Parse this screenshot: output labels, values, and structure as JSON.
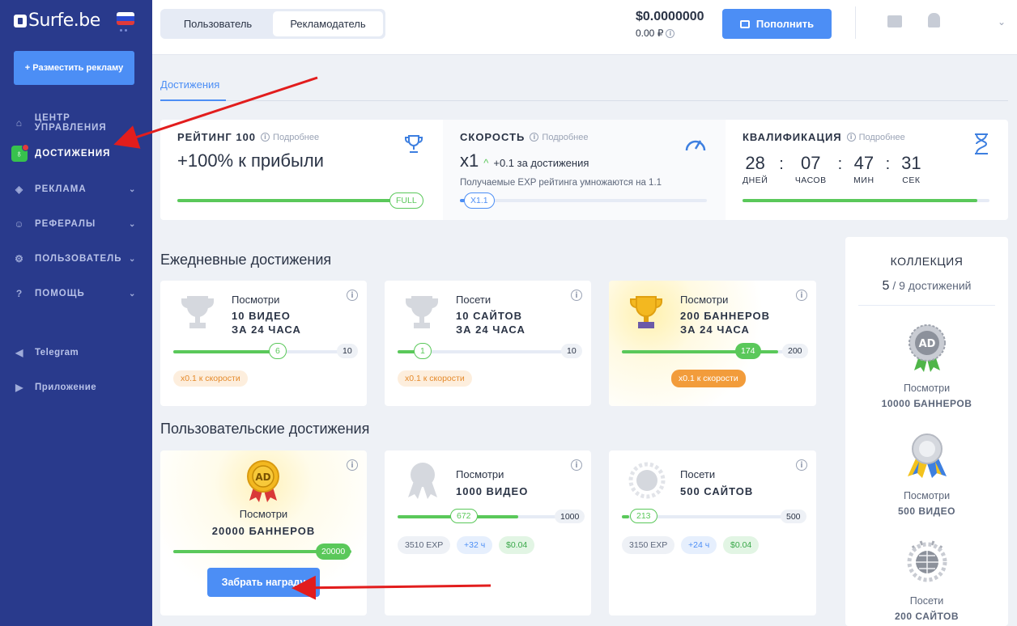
{
  "sidebar": {
    "logo": "Surfe.be",
    "post_ad": "+ Разместить рекламу",
    "items": [
      {
        "label": "ЦЕНТР УПРАВЛЕНИЯ"
      },
      {
        "label": "ДОСТИЖЕНИЯ"
      },
      {
        "label": "РЕКЛАМА"
      },
      {
        "label": "РЕФЕРАЛЫ"
      },
      {
        "label": "ПОЛЬЗОВАТЕЛЬ"
      },
      {
        "label": "ПОМОЩЬ"
      },
      {
        "label": "Telegram"
      },
      {
        "label": "Приложение"
      }
    ]
  },
  "topbar": {
    "tab_user": "Пользователь",
    "tab_advertiser": "Рекламодатель",
    "balance_usd": "$0.0000000",
    "balance_rub": "0.00 ₽",
    "topup": "Пополнить"
  },
  "page_tab": "Достижения",
  "stats": {
    "rating": {
      "title": "РЕЙТИНГ 100",
      "more": "Подробнее",
      "value": "+100% к прибыли",
      "pill": "FULL",
      "progress": 1.0
    },
    "speed": {
      "title": "СКОРОСТЬ",
      "more": "Подробнее",
      "value": "x1",
      "delta": "+0.1 за достижения",
      "desc": "Получаемые EXP рейтинга умножаются на 1.1",
      "pill": "X1.1",
      "progress": 0.02
    },
    "qual": {
      "title": "КВАЛИФИКАЦИЯ",
      "more": "Подробнее",
      "days": "28",
      "hours": "07",
      "mins": "47",
      "secs": "31",
      "l_days": "ДНЕЙ",
      "l_hours": "ЧАСОВ",
      "l_mins": "МИН",
      "l_secs": "СЕК",
      "progress": 0.95
    }
  },
  "daily_title": "Ежедневные достижения",
  "daily": [
    {
      "t1": "Посмотри",
      "t2a": "10 ВИДЕО",
      "t2b": "ЗА 24 ЧАСА",
      "current": "6",
      "max": "10",
      "progress": 0.6,
      "reward": "x0.1 к скорости",
      "done": false
    },
    {
      "t1": "Посети",
      "t2a": "10 САЙТОВ",
      "t2b": "ЗА 24 ЧАСА",
      "current": "1",
      "max": "10",
      "progress": 0.1,
      "reward": "x0.1 к скорости",
      "done": false
    },
    {
      "t1": "Посмотри",
      "t2a": "200 БАННЕРОВ",
      "t2b": "ЗА 24 ЧАСА",
      "current": "174",
      "max": "200",
      "progress": 0.87,
      "reward": "x0.1 к скорости",
      "done": true
    }
  ],
  "user_title": "Пользовательские достижения",
  "user": {
    "claim": {
      "t1": "Посмотри",
      "t2": "20000 БАННЕРОВ",
      "value": "20000",
      "progress": 1.0,
      "button": "Забрать награду"
    },
    "video": {
      "t1": "Посмотри",
      "t2": "1000 ВИДЕО",
      "current": "672",
      "max": "1000",
      "progress": 0.672,
      "exp": "3510 EXP",
      "hours": "+32 ч",
      "money": "$0.04"
    },
    "sites": {
      "t1": "Посети",
      "t2": "500 САЙТОВ",
      "current": "213",
      "max": "500",
      "progress": 0.04,
      "exp": "3150 EXP",
      "hours": "+24 ч",
      "money": "$0.04"
    }
  },
  "collection": {
    "title": "КОЛЛЕКЦИЯ",
    "count": "5",
    "of": "/ 9 достижений",
    "items": [
      {
        "a": "Посмотри",
        "b": "10000 БАННЕРОВ"
      },
      {
        "a": "Посмотри",
        "b": "500 ВИДЕО"
      },
      {
        "a": "Посети",
        "b": "200 САЙТОВ"
      }
    ]
  },
  "colors": {
    "sidebar": "#293a8c",
    "accent": "#4c8ef5",
    "green": "#5ac85a",
    "orange": "#f29c3b"
  }
}
